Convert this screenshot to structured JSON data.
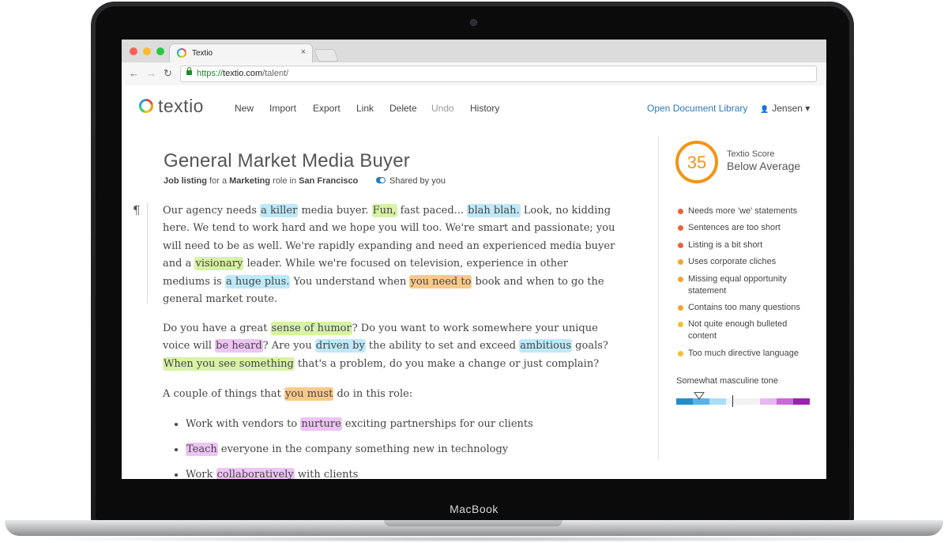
{
  "device": {
    "label": "MacBook"
  },
  "browser": {
    "tab_title": "Textio",
    "tab_close": "×",
    "url_scheme": "https://",
    "url_host": "textio.com",
    "url_path": "/talent/",
    "back_icon": "←",
    "forward_icon": "→",
    "reload_icon": "↻"
  },
  "app": {
    "logo_text": "textio",
    "menu": [
      "New",
      "Import",
      "Export",
      "Link",
      "Delete",
      "Undo",
      "History"
    ],
    "doc_library": "Open Document Library",
    "user": "Jensen ▾",
    "user_icon": "👤"
  },
  "doc": {
    "title": "General Market Media Buyer",
    "meta_prefix1": "Job listing",
    "meta_mid1": " for a ",
    "meta_role": "Marketing",
    "meta_mid2": " role in ",
    "meta_city": "San Francisco",
    "shared": "Shared by you",
    "pilcrow": "¶",
    "p1": [
      {
        "t": "Our agency needs "
      },
      {
        "t": "a killer",
        "c": "hb"
      },
      {
        "t": " media buyer. "
      },
      {
        "t": "Fun,",
        "c": "hg"
      },
      {
        "t": " fast paced... "
      },
      {
        "t": "blah blah.",
        "c": "hb"
      },
      {
        "t": " Look, no kidding here. We tend to work hard and we hope you will too. We're smart and passionate; you will need to be as well. We're rapidly expanding and need an experienced media buyer and a "
      },
      {
        "t": "visionary",
        "c": "hg"
      },
      {
        "t": " leader. While we're focused on television, experience in other mediums is "
      },
      {
        "t": "a huge plus.",
        "c": "hb"
      },
      {
        "t": " You understand when "
      },
      {
        "t": "you need to",
        "c": "ho"
      },
      {
        "t": " book and when to go the general market route."
      }
    ],
    "p2": [
      {
        "t": "Do you have a great "
      },
      {
        "t": "sense of humor",
        "c": "hg"
      },
      {
        "t": "? Do you want to work somewhere your unique voice will "
      },
      {
        "t": "be heard",
        "c": "hp"
      },
      {
        "t": "? Are you "
      },
      {
        "t": "driven by",
        "c": "hb"
      },
      {
        "t": " the ability to set and exceed "
      },
      {
        "t": "ambitious",
        "c": "hb"
      },
      {
        "t": " goals? "
      },
      {
        "t": "When you see something",
        "c": "hg"
      },
      {
        "t": " that's a problem, do you make a change or just complain?"
      }
    ],
    "p3": [
      {
        "t": "A couple of things that "
      },
      {
        "t": "you must",
        "c": "ho"
      },
      {
        "t": " do in this role:"
      }
    ],
    "bullets": [
      [
        {
          "t": "Work with vendors to "
        },
        {
          "t": "nurture",
          "c": "hp"
        },
        {
          "t": " exciting partnerships for our clients"
        }
      ],
      [
        {
          "t": "Teach",
          "c": "hp"
        },
        {
          "t": " everyone in the company something new in technology"
        }
      ],
      [
        {
          "t": "Work "
        },
        {
          "t": "collaboratively",
          "c": "hp"
        },
        {
          "t": " with clients"
        }
      ]
    ]
  },
  "sidebar": {
    "score": "35",
    "score_label": "Textio Score",
    "score_value": "Below Average",
    "issues": [
      {
        "text": "Needs more 'we' statements",
        "color": "#e8643a"
      },
      {
        "text": "Sentences are too short",
        "color": "#e8643a"
      },
      {
        "text": "Listing is a bit short",
        "color": "#e8643a"
      },
      {
        "text": "Uses corporate cliches",
        "color": "#f0a531"
      },
      {
        "text": "Missing equal opportunity statement",
        "color": "#f0a531"
      },
      {
        "text": "Contains too many questions",
        "color": "#f0a531"
      },
      {
        "text": "Not quite enough bulleted content",
        "color": "#f2c12e"
      },
      {
        "text": "Too much directive language",
        "color": "#f2c12e"
      }
    ],
    "tone_label": "Somewhat masculine tone",
    "tone_colors": [
      "#1d8fcf",
      "#52b6e8",
      "#a8def7",
      "#f2f2f2",
      "#f2f2f2",
      "#e8b6f2",
      "#c66ad8",
      "#9c1fb4"
    ]
  }
}
